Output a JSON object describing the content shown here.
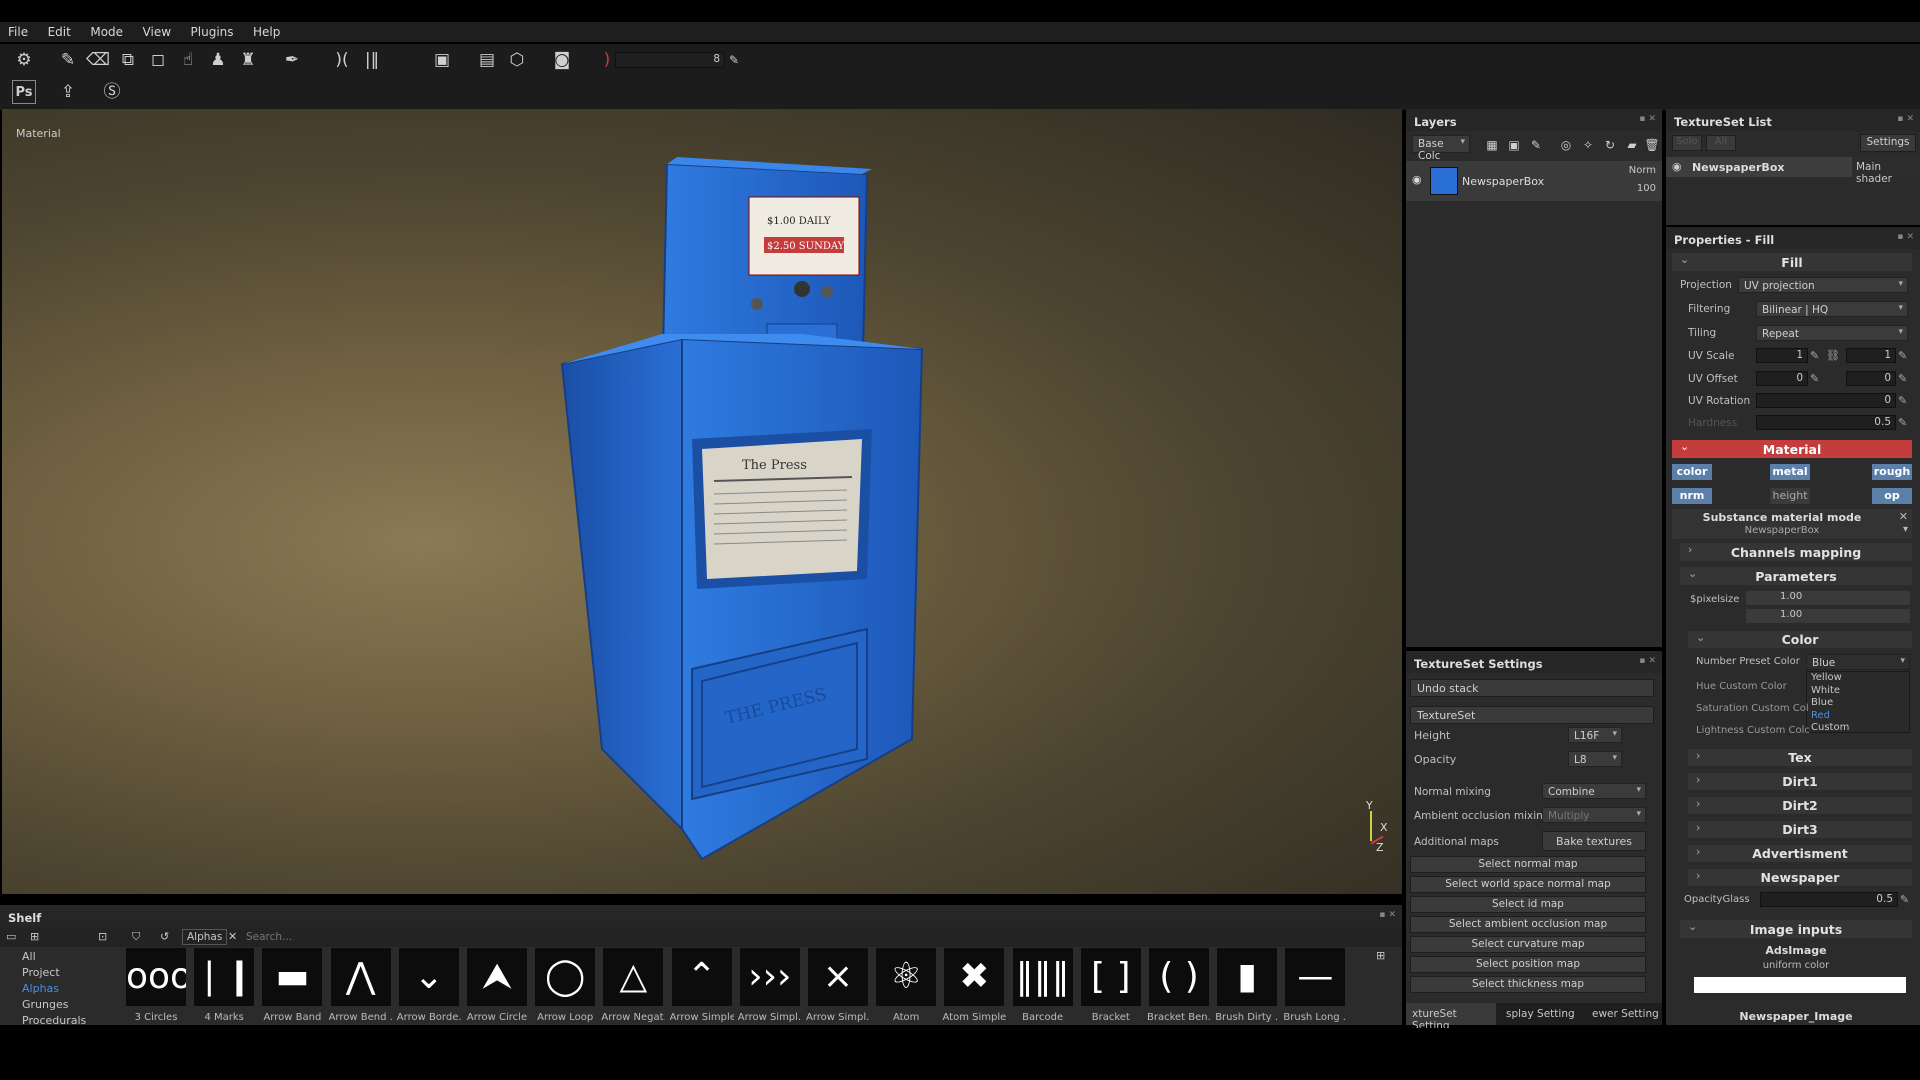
{
  "menu": [
    "File",
    "Edit",
    "Mode",
    "View",
    "Plugins",
    "Help"
  ],
  "toolbar": {
    "brush_size": "8"
  },
  "viewport": {
    "label": "Material",
    "axes": [
      "Y",
      "X",
      "Z"
    ]
  },
  "newspaper_box": {
    "price_daily": "$1.00 DAILY",
    "price_sunday": "$2.50 SUNDAY",
    "paper_name": "The Press",
    "door_text": "THE PRESS"
  },
  "layers": {
    "title": "Layers",
    "channel": "Base Colc",
    "layer": {
      "name": "NewspaperBox",
      "blend": "Norm",
      "opacity": "100"
    }
  },
  "textureset_list": {
    "title": "TextureSet List",
    "solo": "Solo",
    "all": "All",
    "settings": "Settings",
    "item": "NewspaperBox",
    "shader": "Main shader"
  },
  "properties": {
    "title": "Properties - Fill",
    "fill_header": "Fill",
    "projection_label": "Projection",
    "projection_value": "UV projection",
    "filtering_label": "Filtering",
    "filtering_value": "Bilinear | HQ",
    "tiling_label": "Tiling",
    "tiling_value": "Repeat",
    "uv_scale_label": "UV Scale",
    "uv_scale_a": "1",
    "uv_scale_b": "1",
    "uv_offset_label": "UV Offset",
    "uv_offset_a": "0",
    "uv_offset_b": "0",
    "uv_rotation_label": "UV Rotation",
    "uv_rotation": "0",
    "hardness_label": "Hardness",
    "hardness": "0.5",
    "material_header": "Material",
    "chips": [
      "color",
      "metal",
      "rough",
      "nrm",
      "height",
      "op"
    ],
    "substance_mode": "Substance material mode",
    "substance_name": "NewspaperBox",
    "channels_mapping": "Channels mapping",
    "parameters": "Parameters",
    "pixelsize_label": "$pixelsize",
    "pixelsize_a": "1.00",
    "pixelsize_b": "1.00",
    "color_header": "Color",
    "number_preset_label": "Number Preset Color",
    "number_preset_value": "Blue",
    "preset_options": [
      "Yellow",
      "White",
      "Blue",
      "Red",
      "Custom"
    ],
    "hue_label": "Hue Custom Color",
    "sat_label": "Saturation Custom Col",
    "light_label": "Lightness Custom Colc",
    "groups": [
      "Tex",
      "Dirt1",
      "Dirt2",
      "Dirt3",
      "Advertisment",
      "Newspaper"
    ],
    "opacity_glass_label": "OpacityGlass",
    "opacity_glass": "0.5",
    "image_inputs": "Image inputs",
    "ads_image": "AdsImage",
    "uniform_color": "uniform color",
    "newspaper_image": "Newspaper_Image"
  },
  "tss": {
    "title": "TextureSet Settings",
    "undo": "Undo stack",
    "textureset": "TextureSet",
    "height_label": "Height",
    "height_value": "L16F",
    "opacity_label": "Opacity",
    "opacity_value": "L8",
    "normal_mixing_label": "Normal mixing",
    "normal_mixing_value": "Combine",
    "ao_mixing_label": "Ambient occlusion mixing",
    "ao_mixing_value": "Multiply",
    "additional_maps_label": "Additional maps",
    "bake": "Bake textures",
    "maps": [
      "Select normal map",
      "Select world space normal map",
      "Select id map",
      "Select ambient occlusion map",
      "Select curvature map",
      "Select position map",
      "Select thickness map"
    ],
    "tabs": [
      "xtureSet Setting",
      "splay Setting",
      "ewer Setting"
    ]
  },
  "shelf": {
    "title": "Shelf",
    "filter_tag": "Alphas",
    "search_placeholder": "Search...",
    "categories": [
      "All",
      "Project",
      "Alphas",
      "Grunges",
      "Procedurals"
    ],
    "items": [
      {
        "label": "3 Circles",
        "glyph": "ooo"
      },
      {
        "label": "4 Marks",
        "glyph": "❘❙❙❘"
      },
      {
        "label": "Arrow Band",
        "glyph": "▬"
      },
      {
        "label": "Arrow Bend ...",
        "glyph": "⋀"
      },
      {
        "label": "Arrow Borde...",
        "glyph": "⌄"
      },
      {
        "label": "Arrow Circle",
        "glyph": "⮝"
      },
      {
        "label": "Arrow Loop",
        "glyph": "◯"
      },
      {
        "label": "Arrow Negat...",
        "glyph": "△"
      },
      {
        "label": "Arrow Simple",
        "glyph": "⌃"
      },
      {
        "label": "Arrow Simpl...",
        "glyph": "›››"
      },
      {
        "label": "Arrow Simpl...",
        "glyph": "⨯"
      },
      {
        "label": "Atom",
        "glyph": "⚛"
      },
      {
        "label": "Atom Simple",
        "glyph": "✖"
      },
      {
        "label": "Barcode",
        "glyph": "‖‖‖"
      },
      {
        "label": "Bracket",
        "glyph": "[ ]"
      },
      {
        "label": "Bracket Ben...",
        "glyph": "( )"
      },
      {
        "label": "Brush Dirty ...",
        "glyph": "▮"
      },
      {
        "label": "Brush Long ...",
        "glyph": "—"
      }
    ]
  },
  "colors": {
    "accent_red": "#c43c3c",
    "box_blue": "#2a6fd6",
    "panel": "#2b2b2b"
  }
}
